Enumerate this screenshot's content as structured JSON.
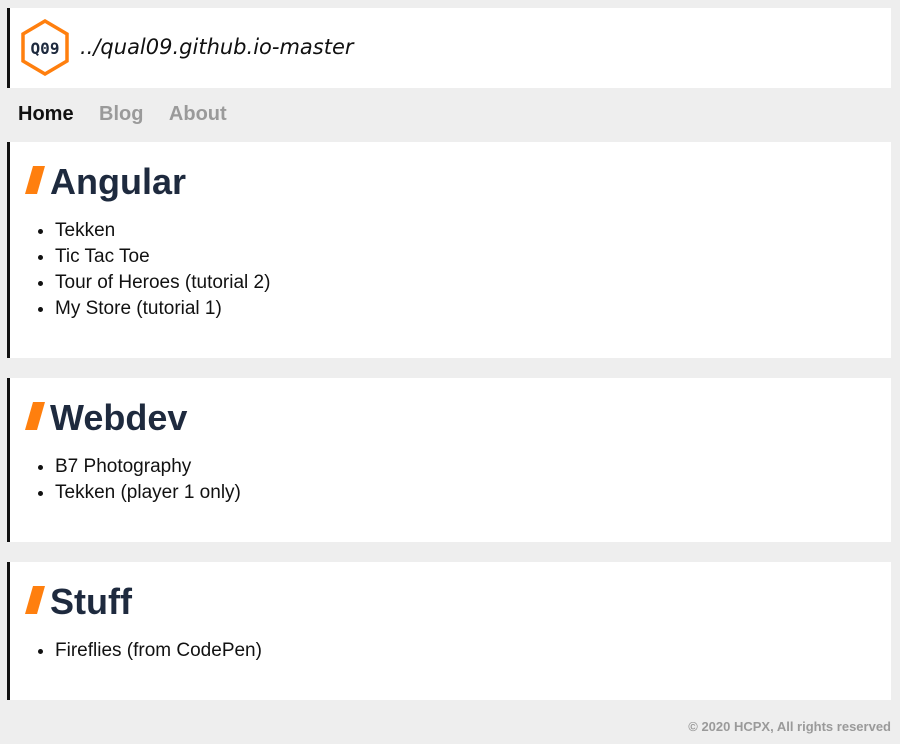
{
  "header": {
    "logo_text": "Q09",
    "site_title": "../qual09.github.io-master"
  },
  "nav": {
    "items": [
      {
        "label": "Home"
      },
      {
        "label": "Blog"
      },
      {
        "label": "About"
      }
    ]
  },
  "sections": [
    {
      "title": "Angular",
      "items": [
        "Tekken",
        "Tic Tac Toe",
        "Tour of Heroes (tutorial 2)",
        "My Store (tutorial 1)"
      ]
    },
    {
      "title": "Webdev",
      "items": [
        "B7 Photography",
        "Tekken (player 1 only)"
      ]
    },
    {
      "title": "Stuff",
      "items": [
        "Fireflies (from CodePen)"
      ]
    }
  ],
  "footer": {
    "text": "© 2020 HCPX, All rights reserved"
  },
  "colors": {
    "accent": "#ff7f0e",
    "title": "#1e2a3e",
    "nav_inactive": "#9a9a9a"
  }
}
